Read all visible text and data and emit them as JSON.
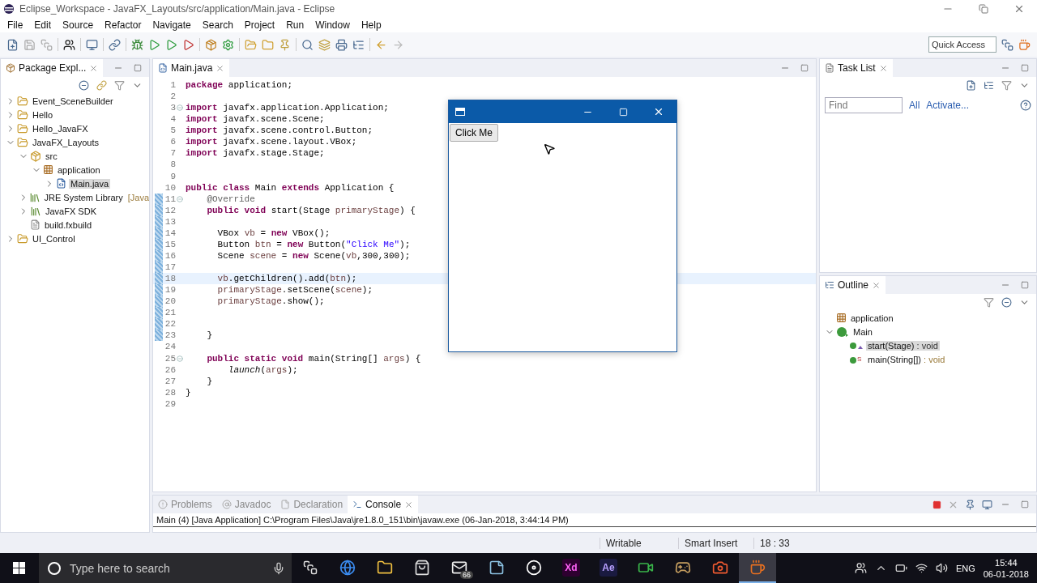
{
  "window": {
    "title": "Eclipse_Workspace - JavaFX_Layouts/src/application/Main.java - Eclipse"
  },
  "menu": [
    "File",
    "Edit",
    "Source",
    "Refactor",
    "Navigate",
    "Search",
    "Project",
    "Run",
    "Window",
    "Help"
  ],
  "toolbar": {
    "quick_access_placeholder": "Quick Access"
  },
  "package_explorer": {
    "title": "Package Expl...",
    "tree": [
      {
        "label": "Event_SceneBuilder",
        "kind": "project",
        "expanded": false,
        "selected": false
      },
      {
        "label": "Hello",
        "kind": "project",
        "expanded": false,
        "selected": false
      },
      {
        "label": "Hello_JavaFX",
        "kind": "project",
        "expanded": false,
        "selected": false
      },
      {
        "label": "JavaFX_Layouts",
        "kind": "project",
        "expanded": true,
        "selected": false,
        "children": [
          {
            "label": "src",
            "kind": "source-folder",
            "expanded": true,
            "selected": false,
            "children": [
              {
                "label": "application",
                "kind": "package",
                "expanded": true,
                "selected": false,
                "children": [
                  {
                    "label": "Main.java",
                    "kind": "java-file",
                    "expanded": false,
                    "selected": true
                  }
                ]
              }
            ]
          },
          {
            "label": "JRE System Library",
            "decoration": "[Java",
            "kind": "library",
            "expanded": false,
            "selected": false
          },
          {
            "label": "JavaFX SDK",
            "kind": "library",
            "expanded": false,
            "selected": false
          },
          {
            "label": "build.fxbuild",
            "kind": "file",
            "selected": false
          }
        ]
      },
      {
        "label": "UI_Control",
        "kind": "project",
        "expanded": false,
        "selected": false
      }
    ]
  },
  "editor": {
    "tab": {
      "label": "Main.java",
      "selected": true
    },
    "lines": [
      {
        "number": "1",
        "fold": false,
        "changed": false,
        "current": false,
        "tokens": [
          {
            "text": "package",
            "kind": "kw"
          },
          {
            "text": " application;",
            "kind": "plain"
          }
        ]
      },
      {
        "number": "2",
        "fold": false,
        "changed": false,
        "current": false
      },
      {
        "number": "3",
        "fold": true,
        "changed": false,
        "current": false,
        "tokens": [
          {
            "text": "import",
            "kind": "kw"
          },
          {
            "text": " javafx.application.Application;",
            "kind": "plain"
          }
        ]
      },
      {
        "number": "4",
        "fold": false,
        "changed": false,
        "current": false,
        "tokens": [
          {
            "text": "import",
            "kind": "kw"
          },
          {
            "text": " javafx.scene.Scene;",
            "kind": "plain"
          }
        ]
      },
      {
        "number": "5",
        "fold": false,
        "changed": false,
        "current": false,
        "tokens": [
          {
            "text": "import",
            "kind": "kw"
          },
          {
            "text": " javafx.scene.control.Button;",
            "kind": "plain"
          }
        ]
      },
      {
        "number": "6",
        "fold": false,
        "changed": false,
        "current": false,
        "tokens": [
          {
            "text": "import",
            "kind": "kw"
          },
          {
            "text": " javafx.scene.layout.VBox;",
            "kind": "plain"
          }
        ]
      },
      {
        "number": "7",
        "fold": false,
        "changed": false,
        "current": false,
        "tokens": [
          {
            "text": "import",
            "kind": "kw"
          },
          {
            "text": " javafx.stage.Stage;",
            "kind": "plain"
          }
        ]
      },
      {
        "number": "8",
        "fold": false,
        "changed": false,
        "current": false
      },
      {
        "number": "9",
        "fold": false,
        "changed": false,
        "current": false
      },
      {
        "number": "10",
        "fold": false,
        "changed": false,
        "current": false,
        "tokens": [
          {
            "text": "public class",
            "kind": "kw"
          },
          {
            "text": " Main ",
            "kind": "plain"
          },
          {
            "text": "extends",
            "kind": "kw"
          },
          {
            "text": " Application {",
            "kind": "plain"
          }
        ]
      },
      {
        "number": "11",
        "fold": true,
        "changed": true,
        "current": false,
        "tokens": [
          {
            "text": "    @Override",
            "kind": "annotation"
          }
        ]
      },
      {
        "number": "12",
        "fold": false,
        "changed": true,
        "current": false,
        "tokens": [
          {
            "text": "    public void",
            "kind": "kw"
          },
          {
            "text": " start(Stage ",
            "kind": "plain"
          },
          {
            "text": "primaryStage",
            "kind": "var"
          },
          {
            "text": ") {",
            "kind": "plain"
          }
        ]
      },
      {
        "number": "13",
        "fold": false,
        "changed": true,
        "current": false
      },
      {
        "number": "14",
        "fold": false,
        "changed": true,
        "current": false,
        "tokens": [
          {
            "text": "      VBox ",
            "kind": "plain"
          },
          {
            "text": "vb",
            "kind": "var"
          },
          {
            "text": " = ",
            "kind": "plain"
          },
          {
            "text": "new",
            "kind": "kw"
          },
          {
            "text": " VBox();",
            "kind": "plain"
          }
        ]
      },
      {
        "number": "15",
        "fold": false,
        "changed": true,
        "current": false,
        "tokens": [
          {
            "text": "      Button ",
            "kind": "plain"
          },
          {
            "text": "btn",
            "kind": "var"
          },
          {
            "text": " = ",
            "kind": "plain"
          },
          {
            "text": "new",
            "kind": "kw"
          },
          {
            "text": " Button(",
            "kind": "plain"
          },
          {
            "text": "\"Click Me\"",
            "kind": "string"
          },
          {
            "text": ");",
            "kind": "plain"
          }
        ]
      },
      {
        "number": "16",
        "fold": false,
        "changed": true,
        "current": false,
        "tokens": [
          {
            "text": "      Scene ",
            "kind": "plain"
          },
          {
            "text": "scene",
            "kind": "var"
          },
          {
            "text": " = ",
            "kind": "plain"
          },
          {
            "text": "new",
            "kind": "kw"
          },
          {
            "text": " Scene(",
            "kind": "plain"
          },
          {
            "text": "vb",
            "kind": "var"
          },
          {
            "text": ",300,300);",
            "kind": "plain"
          }
        ]
      },
      {
        "number": "17",
        "fold": false,
        "changed": true,
        "current": false
      },
      {
        "number": "18",
        "fold": false,
        "changed": true,
        "current": true,
        "tokens": [
          {
            "text": "      vb",
            "kind": "var"
          },
          {
            "text": ".getChildren().add(",
            "kind": "plain"
          },
          {
            "text": "btn",
            "kind": "var"
          },
          {
            "text": ");",
            "kind": "plain"
          }
        ]
      },
      {
        "number": "19",
        "fold": false,
        "changed": true,
        "current": false,
        "tokens": [
          {
            "text": "      primaryStage",
            "kind": "var"
          },
          {
            "text": ".setScene(",
            "kind": "plain"
          },
          {
            "text": "scene",
            "kind": "var"
          },
          {
            "text": ");",
            "kind": "plain"
          }
        ]
      },
      {
        "number": "20",
        "fold": false,
        "changed": true,
        "current": false,
        "tokens": [
          {
            "text": "      primaryStage",
            "kind": "var"
          },
          {
            "text": ".show();",
            "kind": "plain"
          }
        ]
      },
      {
        "number": "21",
        "fold": false,
        "changed": true,
        "current": false
      },
      {
        "number": "22",
        "fold": false,
        "changed": true,
        "current": false
      },
      {
        "number": "23",
        "fold": false,
        "changed": true,
        "current": false,
        "tokens": [
          {
            "text": "    }",
            "kind": "plain"
          }
        ]
      },
      {
        "number": "24",
        "fold": false,
        "changed": false,
        "current": false
      },
      {
        "number": "25",
        "fold": true,
        "changed": false,
        "current": false,
        "tokens": [
          {
            "text": "    public static void",
            "kind": "kw"
          },
          {
            "text": " main(String[] ",
            "kind": "plain"
          },
          {
            "text": "args",
            "kind": "var"
          },
          {
            "text": ") {",
            "kind": "plain"
          }
        ]
      },
      {
        "number": "26",
        "fold": false,
        "changed": false,
        "current": false,
        "tokens": [
          {
            "text": "        launch",
            "kind": "static"
          },
          {
            "text": "(",
            "kind": "plain"
          },
          {
            "text": "args",
            "kind": "var"
          },
          {
            "text": ");",
            "kind": "plain"
          }
        ]
      },
      {
        "number": "27",
        "fold": false,
        "changed": false,
        "current": false,
        "tokens": [
          {
            "text": "    }",
            "kind": "plain"
          }
        ]
      },
      {
        "number": "28",
        "fold": false,
        "changed": false,
        "current": false,
        "tokens": [
          {
            "text": "}",
            "kind": "plain"
          }
        ]
      },
      {
        "number": "29",
        "fold": false,
        "changed": false,
        "current": false
      }
    ]
  },
  "app_window": {
    "button": "Click Me"
  },
  "task_list": {
    "title": "Task List",
    "find_placeholder": "Find",
    "links": [
      "All",
      "Activate..."
    ]
  },
  "outline": {
    "title": "Outline",
    "tree": [
      {
        "label": "application",
        "kind": "package",
        "selected": false
      },
      {
        "label": "Main",
        "kind": "class",
        "expanded": true,
        "selected": false,
        "children": [
          {
            "label": "start(Stage)",
            "type": " : void",
            "kind": "override",
            "selected": true
          },
          {
            "label": "main(String[])",
            "type": " : void",
            "kind": "static",
            "badge": "S",
            "selected": false
          }
        ]
      }
    ]
  },
  "console": {
    "tabs": [
      {
        "label": "Problems",
        "kind": "problems",
        "selected": false
      },
      {
        "label": "Javadoc",
        "kind": "javadoc",
        "selected": false
      },
      {
        "label": "Declaration",
        "kind": "declaration",
        "selected": false
      },
      {
        "label": "Console",
        "kind": "console",
        "selected": true
      }
    ],
    "launch": "Main (4) [Java Application] C:\\Program Files\\Java\\jre1.8.0_151\\bin\\javaw.exe (06-Jan-2018, 3:44:14 PM)"
  },
  "status_bar": [
    "Writable",
    "Smart Insert",
    "18 : 33"
  ],
  "taskbar": {
    "search_placeholder": "Type here to search",
    "apps": [
      {
        "kind": "browser",
        "selected": false
      },
      {
        "kind": "folder",
        "selected": false
      },
      {
        "kind": "store",
        "selected": false
      },
      {
        "kind": "mail",
        "badge": "66",
        "selected": false
      },
      {
        "kind": "notes",
        "selected": false
      },
      {
        "kind": "media",
        "selected": false
      },
      {
        "kind": "xd",
        "label": "Xd",
        "selected": false
      },
      {
        "kind": "ae",
        "label": "Ae",
        "selected": false
      },
      {
        "kind": "camtasia",
        "selected": false
      },
      {
        "kind": "game",
        "selected": false
      },
      {
        "kind": "recorder",
        "selected": false
      },
      {
        "kind": "java",
        "selected": true
      }
    ],
    "language": "ENG",
    "time": "15:44",
    "date": "06-01-2018"
  }
}
